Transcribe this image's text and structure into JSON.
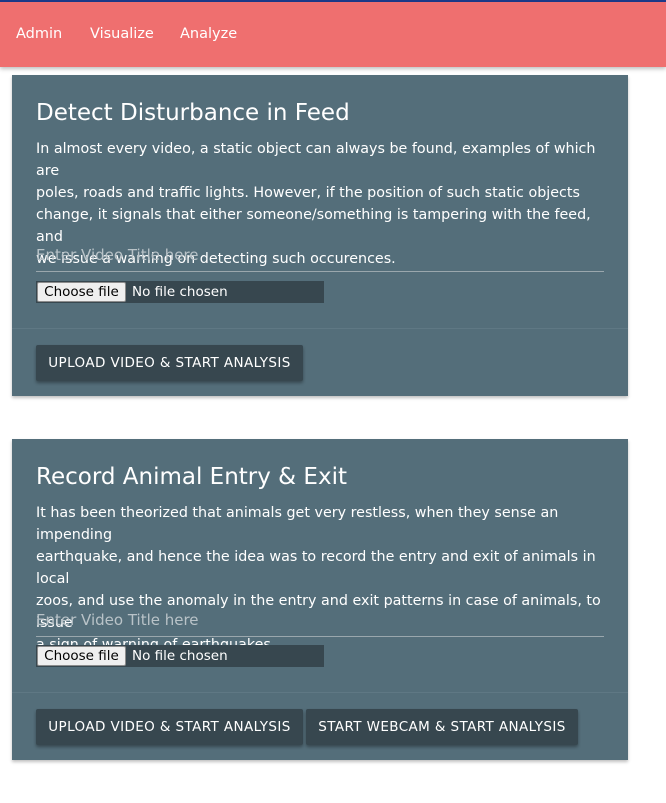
{
  "navbar": {
    "items": [
      {
        "label": "Admin"
      },
      {
        "label": "Visualize"
      },
      {
        "label": "Analyze"
      }
    ]
  },
  "cards": [
    {
      "title": "Detect Disturbance in Feed",
      "lines": [
        "In almost every video, a static object can always be found, examples of which are",
        "poles, roads and traffic lights. However, if the position of such static objects",
        "change, it signals that either someone/something is tampering with the feed, and",
        "we issue a warning on detecting such occurences."
      ],
      "input_placeholder": "Enter Video Title here",
      "input_value": "",
      "file_button": "Choose file",
      "file_status": "No file chosen",
      "buttons": [
        "UPLOAD VIDEO & START ANALYSIS"
      ]
    },
    {
      "title": "Record Animal Entry & Exit",
      "lines": [
        "It has been theorized that animals get very restless, when they sense an impending",
        "earthquake, and hence the idea was to record the entry and exit of animals in local",
        "zoos, and use the anomaly in the entry and exit patterns in case of animals, to issue",
        "a sign of warning of earthquakes."
      ],
      "input_placeholder": "Enter Video Title here",
      "input_value": "",
      "file_button": "Choose file",
      "file_status": "No file chosen",
      "buttons": [
        "UPLOAD VIDEO & START ANALYSIS",
        "START WEBCAM & START ANALYSIS"
      ]
    }
  ],
  "colors": {
    "navbar": "#ef6f6f",
    "card": "#546e7a",
    "button": "#37474f"
  }
}
